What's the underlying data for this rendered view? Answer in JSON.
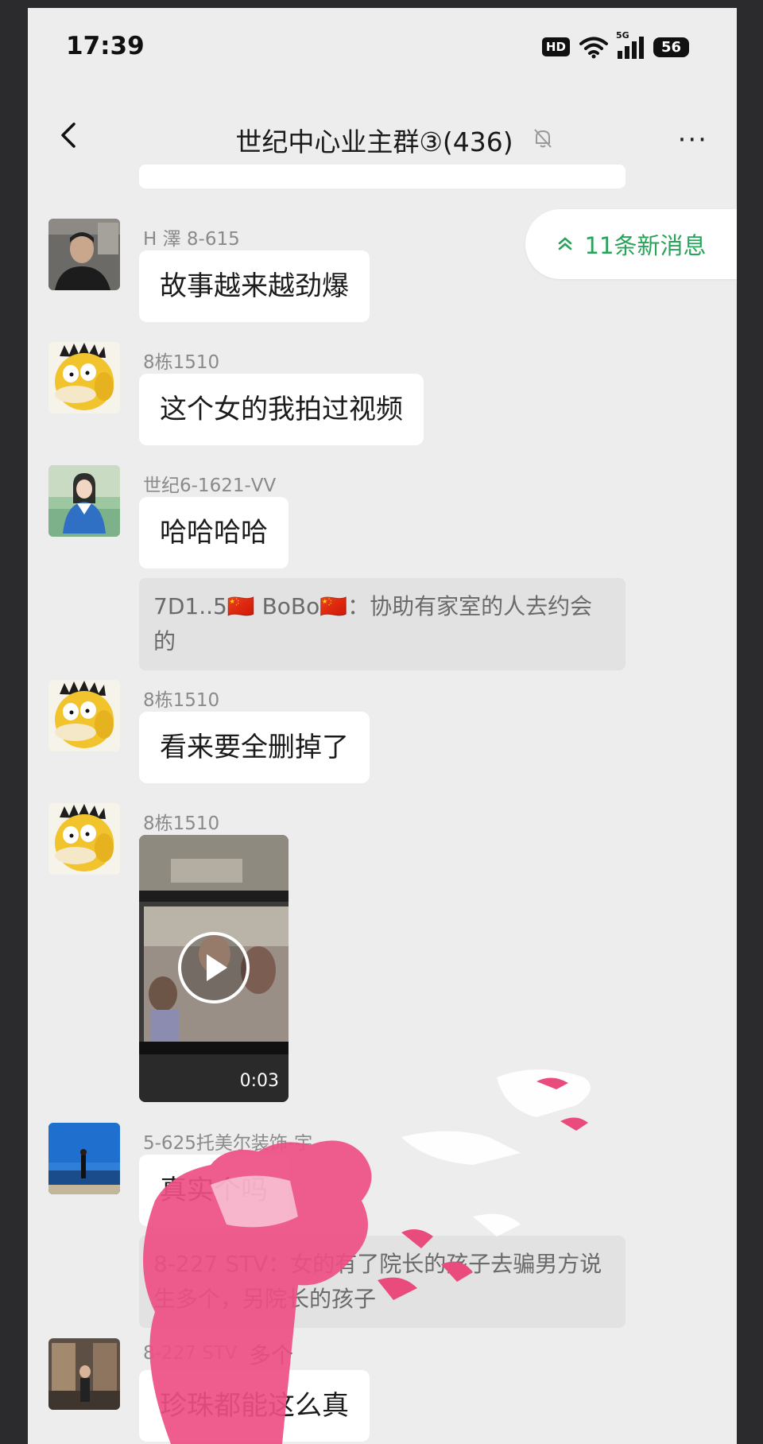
{
  "status_bar": {
    "time": "17:39",
    "hd_badge": "HD",
    "network": "5G",
    "battery": "56",
    "icons": [
      "wifi-icon",
      "signal-icon",
      "battery-icon"
    ]
  },
  "header": {
    "title": "世纪中心业主群③(436)",
    "icons": [
      "back-icon",
      "mute-bell-icon",
      "more-icon"
    ],
    "more_label": "···"
  },
  "new_messages_pill": {
    "label": "11条新消息",
    "accent_color": "#2aa35a"
  },
  "messages": [
    {
      "sender": "H 澤 8-615",
      "text": "故事越来越劲爆"
    },
    {
      "sender": "8栋1510",
      "text": "这个女的我拍过视频"
    },
    {
      "sender": "世纪6-1621-VV",
      "text": "哈哈哈哈",
      "quote": "7D1..5🇨🇳 BoBo🇨🇳：协助有家室的人去约会的"
    },
    {
      "sender": "8栋1510",
      "text": "看来要全删掉了"
    },
    {
      "sender": "8栋1510",
      "video_duration": "0:03"
    },
    {
      "sender": "5-625托美尔装饰-宇",
      "text": "真实个吗",
      "quote": "8-227 STV：女的有了院长的孩子去骗男方说生多个，另院长的孩子"
    },
    {
      "sender": "8-227 STV",
      "text": "珍珠都能这么真",
      "overlay_text": "多个"
    }
  ]
}
